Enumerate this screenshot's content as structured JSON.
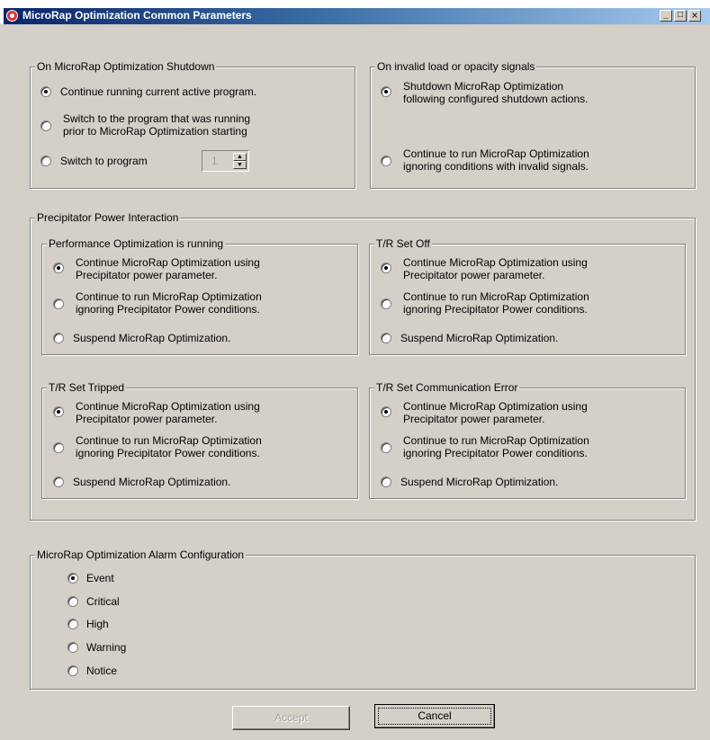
{
  "window": {
    "title": "MicroRap Optimization Common Parameters",
    "minimize": "_",
    "maximize": "□",
    "close": "×"
  },
  "shutdown": {
    "legend": "On MicroRap Optimization Shutdown",
    "opt1": "Continue running current active program.",
    "opt2_l1": "Switch to the program that was running",
    "opt2_l2": "prior to MicroRap Optimization starting",
    "opt3": "Switch to program",
    "program_value": "1",
    "selected": 1
  },
  "invalid": {
    "legend": "On invalid load or opacity signals",
    "opt1_l1": "Shutdown MicroRap Optimization",
    "opt1_l2": "following configured shutdown actions.",
    "opt2_l1": "Continue to run MicroRap Optimization",
    "opt2_l2": "ignoring conditions with invalid signals.",
    "selected": 1
  },
  "power": {
    "legend": "Precipitator Power Interaction",
    "groups": [
      {
        "legend": "Performance Optimization is running",
        "opt1_l1": "Continue MicroRap Optimization using",
        "opt1_l2": "Precipitator power parameter.",
        "opt2_l1": "Continue to run MicroRap Optimization",
        "opt2_l2": "ignoring Precipitator Power conditions.",
        "opt3": "Suspend MicroRap Optimization.",
        "selected": 1
      },
      {
        "legend": "T/R Set Off",
        "opt1_l1": "Continue MicroRap Optimization using",
        "opt1_l2": "Precipitator power parameter.",
        "opt2_l1": "Continue to run MicroRap Optimization",
        "opt2_l2": "ignoring Precipitator Power conditions.",
        "opt3": "Suspend MicroRap Optimization.",
        "selected": 1
      },
      {
        "legend": "T/R Set Tripped",
        "opt1_l1": "Continue MicroRap Optimization using",
        "opt1_l2": "Precipitator power parameter.",
        "opt2_l1": "Continue to run MicroRap Optimization",
        "opt2_l2": "ignoring Precipitator Power conditions.",
        "opt3": "Suspend MicroRap Optimization.",
        "selected": 1
      },
      {
        "legend": "T/R Set Communication Error",
        "opt1_l1": "Continue MicroRap Optimization using",
        "opt1_l2": "Precipitator power parameter.",
        "opt2_l1": "Continue to run MicroRap Optimization",
        "opt2_l2": "ignoring Precipitator Power conditions.",
        "opt3": "Suspend MicroRap Optimization.",
        "selected": 1
      }
    ]
  },
  "alarm": {
    "legend": "MicroRap Optimization Alarm Configuration",
    "options": [
      "Event",
      "Critical",
      "High",
      "Warning",
      "Notice"
    ],
    "selected": "Event"
  },
  "buttons": {
    "accept": "Accept",
    "cancel": "Cancel"
  }
}
